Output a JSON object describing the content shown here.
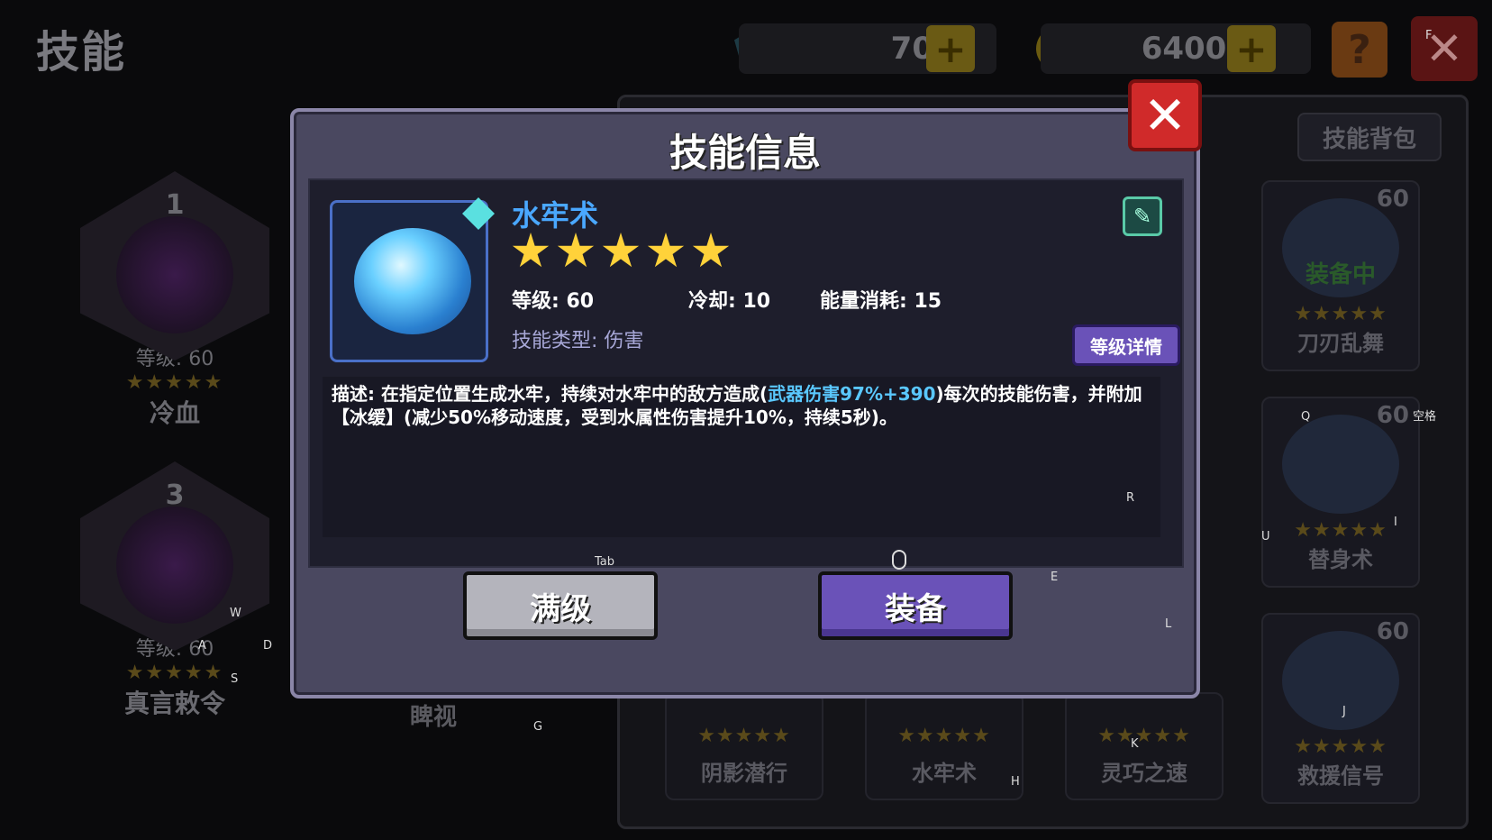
{
  "screen": {
    "title": "技能",
    "gems": "70",
    "coins": "64000",
    "help_label": "?",
    "close_label": "✕"
  },
  "left_skills": [
    {
      "slot": "1",
      "level": "等级: 60",
      "stars": "★★★★★",
      "name": "冷血"
    },
    {
      "slot": "3",
      "level": "等级: 60",
      "stars": "★★★★★",
      "name": "真言敕令"
    }
  ],
  "middle_skill_name": "睥视",
  "bag_tab": "技能背包",
  "grid_cards": [
    {
      "level": "60",
      "stars": "★★★★★",
      "name": "刀刃乱舞",
      "status": "装备中"
    },
    {
      "level": "60",
      "stars": "★★★★★",
      "name": "替身术",
      "status": ""
    },
    {
      "level": "60",
      "stars": "★★★★★",
      "name": "救援信号",
      "status": ""
    }
  ],
  "bottom_cards": [
    {
      "stars": "★★★★★",
      "name": "阴影潜行"
    },
    {
      "stars": "★★★★★",
      "name": "水牢术"
    },
    {
      "stars": "★★★★★",
      "name": "灵巧之速"
    }
  ],
  "modal": {
    "title": "技能信息",
    "close_label": "✕",
    "skill_name": "水牢术",
    "star_count": 5,
    "level": "等级: 60",
    "cooldown": "冷却: 10",
    "energy": "能量消耗: 15",
    "skill_type": "技能类型: 伤害",
    "level_detail_button": "等级详情",
    "description_prefix": "描述: 在指定位置生成水牢，持续对水牢中的敌方造成(",
    "description_highlight": "武器伤害97%+390",
    "description_suffix": ")每次的技能伤害，并附加【冰缓】(减少50%移动速度，受到水属性伤害提升10%，持续5秒)。",
    "max_level_button": "满级",
    "equip_button": "装备"
  },
  "key_hints": {
    "F": "F",
    "Q": "Q",
    "space": "空格",
    "R": "R",
    "U": "U",
    "I": "I",
    "tab": "Tab",
    "E": "E",
    "W": "W",
    "A": "A",
    "D": "D",
    "S": "S",
    "L": "L",
    "J": "J",
    "G": "G",
    "K": "K",
    "H": "H"
  },
  "colors": {
    "skill_name": "#4aa8ff",
    "highlight": "#5ac8ff",
    "star": "#ffd23a",
    "close": "#d02a2a",
    "equip_button": "#6a52b8"
  }
}
